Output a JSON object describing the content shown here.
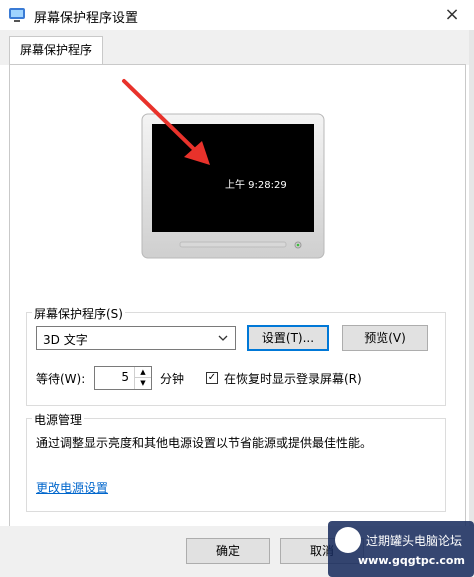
{
  "window": {
    "title": "屏幕保护程序设置",
    "close_glyph": "×"
  },
  "tabs": [
    {
      "label": "屏幕保护程序"
    }
  ],
  "preview": {
    "time_text": "上午 9:28:29"
  },
  "screensaver_group": {
    "label": "屏幕保护程序(S)",
    "selected": "3D 文字",
    "settings_button": "设置(T)...",
    "preview_button": "预览(V)",
    "wait_label": "等待(W):",
    "wait_value": "5",
    "wait_unit": "分钟",
    "resume_checkbox_label": "在恢复时显示登录屏幕(R)",
    "resume_checked": true
  },
  "power_group": {
    "label": "电源管理",
    "description": "通过调整显示亮度和其他电源设置以节省能源或提供最佳性能。",
    "link": "更改电源设置"
  },
  "footer": {
    "ok_button": "确定",
    "cancel_button": "取消"
  },
  "watermark": {
    "name": "过期罐头电脑论坛",
    "url": "www.gqgtpc.com"
  },
  "colors": {
    "accent": "#0078d7",
    "link": "#0066cc",
    "arrow": "#e8322b"
  }
}
